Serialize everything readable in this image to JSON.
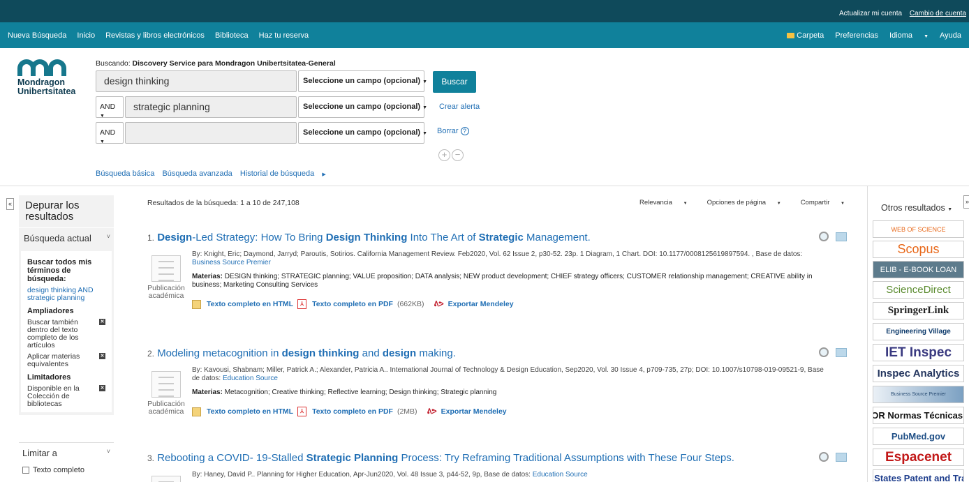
{
  "topbar": {
    "update_account": "Actualizar mi cuenta",
    "change_account": "Cambio de cuenta"
  },
  "nav": {
    "left": [
      "Nueva Búsqueda",
      "Inicio",
      "Revistas y libros electrónicos",
      "Biblioteca",
      "Haz tu reserva"
    ],
    "folder": "Carpeta",
    "preferences": "Preferencias",
    "language": "Idioma",
    "help": "Ayuda"
  },
  "logo": {
    "line1": "Mondragon",
    "line2": "Unibertsitatea"
  },
  "search": {
    "searching_label": "Buscando:",
    "searching_value": "Discovery Service para Mondragon Unibertsitatea-General",
    "rows": [
      {
        "op": "",
        "value": "design thinking",
        "field": "Seleccione un campo (opcional)"
      },
      {
        "op": "AND",
        "value": "strategic planning",
        "field": "Seleccione un campo (opcional)"
      },
      {
        "op": "AND",
        "value": "",
        "field": "Seleccione un campo (opcional)"
      }
    ],
    "search_button": "Buscar",
    "create_alert": "Crear alerta",
    "clear": "Borrar",
    "basic": "Búsqueda básica",
    "advanced": "Búsqueda avanzada",
    "history": "Historial de búsqueda"
  },
  "sidebar": {
    "title": "Depurar los resultados",
    "current_search": "Búsqueda actual",
    "find_all": "Buscar todos mis términos de búsqueda:",
    "query": "design thinking AND strategic planning",
    "expanders": "Ampliadores",
    "expander_items": [
      "Buscar también dentro del texto completo de los artículos",
      "Aplicar materias equivalentes"
    ],
    "limiters": "Limitadores",
    "limiter_items": [
      "Disponible en la Colección de bibliotecas"
    ],
    "limit_to": "Limitar a",
    "full_text": "Texto completo"
  },
  "results": {
    "summary": "Resultados de la búsqueda: 1 a 10 de 247,108",
    "sort": [
      "Relevancia",
      "Opciones de página",
      "Compartir"
    ],
    "items": [
      {
        "num": "1.",
        "title_parts": [
          {
            "t": "Design",
            "b": true
          },
          {
            "t": "-Led Strategy: How To Bring ",
            "b": false
          },
          {
            "t": "Design Thinking",
            "b": true
          },
          {
            "t": " Into The Art of ",
            "b": false
          },
          {
            "t": "Strategic",
            "b": true
          },
          {
            "t": " Management.",
            "b": false
          }
        ],
        "meta": "By: Knight, Eric; Daymond, Jarryd; Paroutis, Sotirios. California Management Review. Feb2020, Vol. 62 Issue 2, p30-52. 23p. 1 Diagram, 1 Chart. DOI: 10.1177/0008125619897594. , Base de datos:",
        "database": "Business Source Premier",
        "type": "Publicación académica",
        "subjects_label": "Materias:",
        "subjects": "DESIGN thinking; STRATEGIC planning; VALUE proposition; DATA analysis; NEW product development; CHIEF strategy officers; CUSTOMER relationship management; CREATIVE ability in business; Marketing Consulting Services",
        "html": "Texto completo en HTML",
        "pdf": "Texto completo en PDF",
        "pdf_size": "(662KB)",
        "mendeley": "Exportar Mendeley"
      },
      {
        "num": "2.",
        "title_parts": [
          {
            "t": "Modeling metacognition in ",
            "b": false
          },
          {
            "t": "design thinking",
            "b": true
          },
          {
            "t": " and ",
            "b": false
          },
          {
            "t": "design",
            "b": true
          },
          {
            "t": " making.",
            "b": false
          }
        ],
        "meta": "By: Kavousi, Shabnam; Miller, Patrick A.; Alexander, Patricia A.. International Journal of Technology & Design Education, Sep2020, Vol. 30 Issue 4, p709-735, 27p; DOI: 10.1007/s10798-019-09521-9, Base de datos:",
        "database": "Education Source",
        "type": "Publicación académica",
        "subjects_label": "Materias:",
        "subjects": "Metacognition; Creative thinking; Reflective learning; Design thinking; Strategic planning",
        "html": "Texto completo en HTML",
        "pdf": "Texto completo en PDF",
        "pdf_size": "(2MB)",
        "mendeley": "Exportar Mendeley"
      },
      {
        "num": "3.",
        "title_parts": [
          {
            "t": "Rebooting a COVID- 19-Stalled ",
            "b": false
          },
          {
            "t": "Strategic Planning",
            "b": true
          },
          {
            "t": " Process: Try Reframing Traditional Assumptions with These Four Steps.",
            "b": false
          }
        ],
        "meta": "By: Haney, David P.. Planning for Higher Education, Apr-Jun2020, Vol. 48 Issue 3, p44-52, 9p, Base de datos:",
        "database": "Education Source"
      }
    ]
  },
  "right": {
    "other_results": "Otros resultados",
    "databases": [
      "WEB OF SCIENCE",
      "Scopus",
      "ELIB - E-BOOK LOAN",
      "ScienceDirect",
      "SpringerLink",
      "Engineering Village",
      "IET Inspec",
      "Inspec Analytics",
      "Business Source Premier",
      "AENOR Normas Técnicas UNE",
      "PubMed.gov",
      "Espacenet",
      "USPTO United States Patent and Trademark Office"
    ]
  }
}
